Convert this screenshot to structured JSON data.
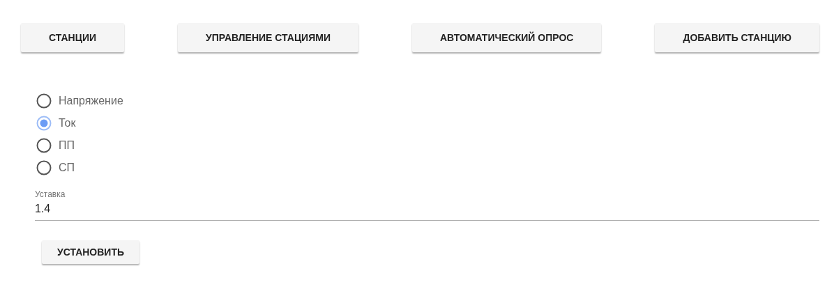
{
  "nav_buttons": [
    {
      "label": "СТАНЦИИ"
    },
    {
      "label": "УПРАВЛЕНИЕ СТАЦИЯМИ"
    },
    {
      "label": "АВТОМАТИЧЕСКИЙ ОПРОС"
    },
    {
      "label": "ДОБАВИТЬ СТАНЦИЮ"
    }
  ],
  "radio_options": [
    {
      "label": "Напряжение",
      "selected": false
    },
    {
      "label": "Ток",
      "selected": true
    },
    {
      "label": "ПП",
      "selected": false
    },
    {
      "label": "СП",
      "selected": false
    }
  ],
  "setpoint_field": {
    "label": "Уставка",
    "value": "1.4"
  },
  "submit_button": {
    "label": "УСТАНОВИТЬ"
  }
}
